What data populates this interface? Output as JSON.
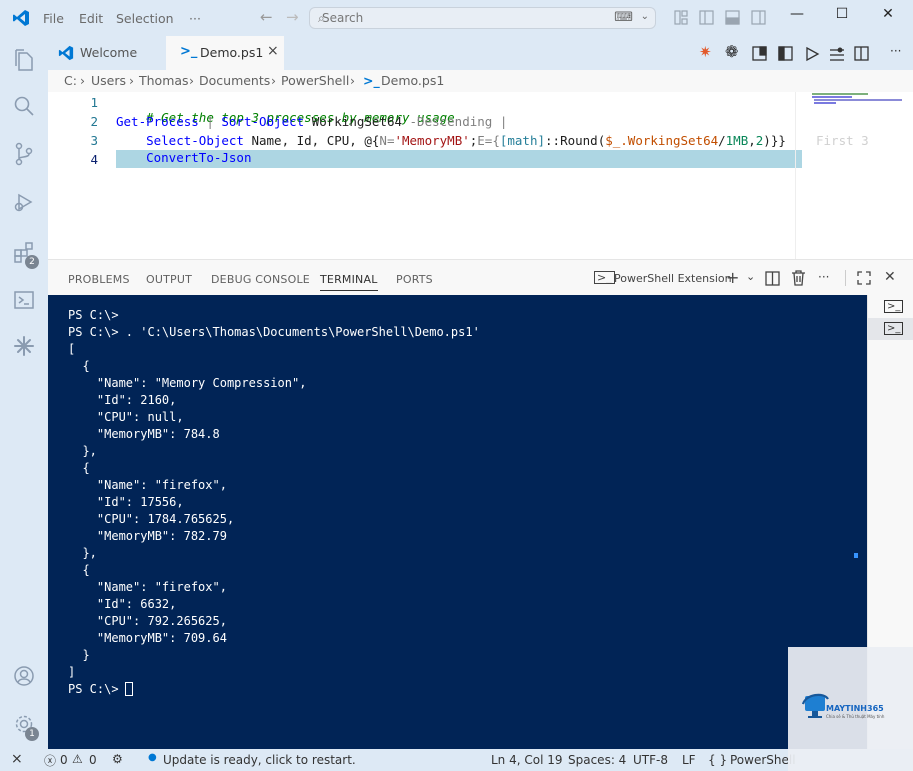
{
  "menu": {
    "file": "File",
    "edit": "Edit",
    "selection": "Selection",
    "more": "···"
  },
  "search": {
    "placeholder": "Search"
  },
  "tabs": [
    {
      "label": "Welcome",
      "active": false
    },
    {
      "label": "Demo.ps1",
      "active": true,
      "close": "×"
    }
  ],
  "breadcrumb": {
    "drive": "C:",
    "p1": "Users",
    "p2": "Thomas",
    "p3": "Documents",
    "p4": "PowerShell",
    "file": "Demo.ps1",
    "sep": "›"
  },
  "editor": {
    "line_numbers": [
      "1",
      "2",
      "3",
      "4"
    ],
    "line1": "# Get the top 3 processes by memory usage",
    "line2": {
      "cmd1": "Get-Process",
      "pipe1": " | ",
      "cmd2": "Sort-Object",
      "arg": " WorkingSet64 ",
      "param": "-Descending",
      "pipe2": " |"
    },
    "line3": {
      "indent": "    ",
      "cmd": "Select-Object",
      "args": " Name, Id, CPU, @{",
      "n": "N=",
      "nstr": "'MemoryMB'",
      "semi": ";",
      "e": "E={",
      "math": "[math]",
      "round": "::Round(",
      "var": "$_.WorkingSet64",
      "div": "/",
      "mb": "1MB",
      "comma": ",",
      "two": "2",
      "close": ")}}",
      "ghost": "First 3"
    },
    "line4": {
      "indent": "    ",
      "cmd": "ConvertTo-Json"
    }
  },
  "panel": {
    "tabs": [
      "PROBLEMS",
      "OUTPUT",
      "DEBUG CONSOLE",
      "TERMINAL",
      "PORTS"
    ],
    "active_tab": "TERMINAL",
    "terminal_name": "PowerShell Extension"
  },
  "terminal": {
    "lines": [
      "PS C:\\>",
      "PS C:\\> . 'C:\\Users\\Thomas\\Documents\\PowerShell\\Demo.ps1'",
      "[",
      "  {",
      "    \"Name\": \"Memory Compression\",",
      "    \"Id\": 2160,",
      "    \"CPU\": null,",
      "    \"MemoryMB\": 784.8",
      "  },",
      "  {",
      "    \"Name\": \"firefox\",",
      "    \"Id\": 17556,",
      "    \"CPU\": 1784.765625,",
      "    \"MemoryMB\": 782.79",
      "  },",
      "  {",
      "    \"Name\": \"firefox\",",
      "    \"Id\": 6632,",
      "    \"CPU\": 792.265625,",
      "    \"MemoryMB\": 709.64",
      "  }",
      "]",
      "PS C:\\>"
    ]
  },
  "activity_badges": {
    "extensions": "2",
    "settings": "1"
  },
  "status": {
    "errors": "0",
    "warnings": "0",
    "update": "Update is ready, click to restart.",
    "position": "Ln 4, Col 19",
    "spaces": "Spaces: 4",
    "encoding": "UTF-8",
    "eol": "LF",
    "braces": "{ }",
    "language": "PowerShell"
  },
  "watermark": {
    "brand": "MAYTINH365",
    "tagline": "Chia sẻ & Thủ thuật Máy tính"
  },
  "colors": {
    "terminal_bg": "#012456",
    "accent": "#0078d4",
    "chrome_bg": "#dde9f5"
  }
}
